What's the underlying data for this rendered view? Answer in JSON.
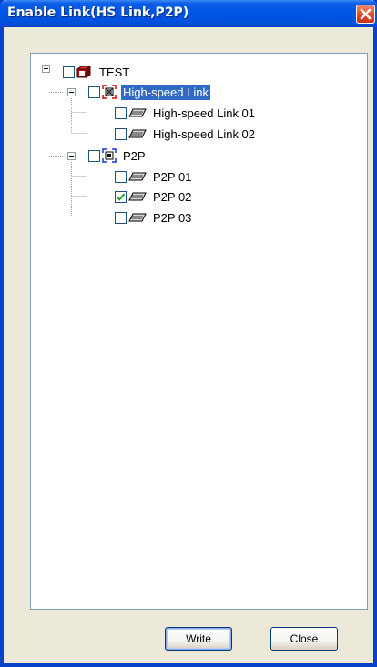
{
  "window": {
    "title": "Enable Link(HS Link,P2P)"
  },
  "tree": {
    "root": {
      "label": "TEST",
      "checked": false,
      "expanded": true,
      "icon": "project-icon"
    },
    "groups": [
      {
        "label": "High-speed Link",
        "checked": false,
        "expanded": true,
        "selected": true,
        "icon": "hs-link-icon",
        "items": [
          {
            "label": "High-speed Link 01",
            "checked": false,
            "icon": "link-item-icon"
          },
          {
            "label": "High-speed Link 02",
            "checked": false,
            "icon": "link-item-icon"
          }
        ]
      },
      {
        "label": "P2P",
        "checked": false,
        "expanded": true,
        "selected": false,
        "icon": "p2p-icon",
        "items": [
          {
            "label": "P2P 01",
            "checked": false,
            "icon": "link-item-icon"
          },
          {
            "label": "P2P 02",
            "checked": true,
            "icon": "link-item-icon"
          },
          {
            "label": "P2P 03",
            "checked": false,
            "icon": "link-item-icon"
          }
        ]
      }
    ]
  },
  "buttons": {
    "write_label": "Write",
    "close_label": "Close"
  },
  "colors": {
    "titlebar": "#0054e3",
    "selection": "#316ac5",
    "checkmark": "#21a121",
    "close": "#e0492a"
  }
}
